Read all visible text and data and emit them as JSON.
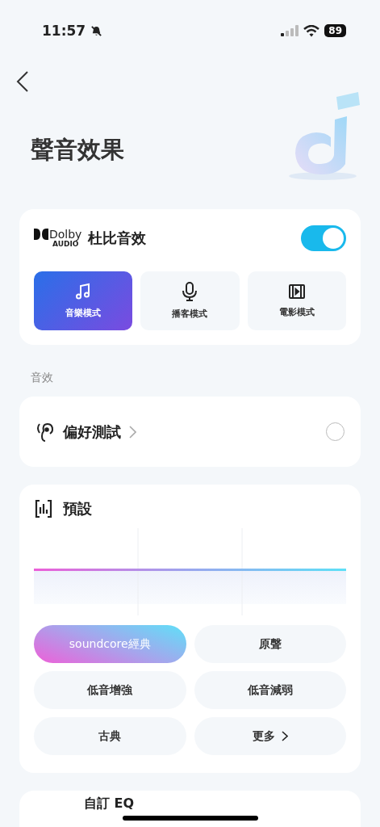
{
  "status_bar": {
    "time": "11:57",
    "battery": "89"
  },
  "header": {
    "title": "聲音效果"
  },
  "dolby": {
    "logo_word": "Dolby",
    "logo_sub": "AUDIO",
    "label": "杜比音效",
    "on": true,
    "modes": [
      {
        "label": "音樂模式",
        "kind": "music",
        "selected": true
      },
      {
        "label": "播客模式",
        "kind": "podcast",
        "selected": false
      },
      {
        "label": "電影模式",
        "kind": "movie",
        "selected": false
      }
    ]
  },
  "section_label": "音效",
  "preference_test": {
    "label": "偏好測試",
    "checked": false
  },
  "preset": {
    "title": "預設",
    "options": [
      {
        "label": "soundcore經典",
        "selected": true,
        "kind": "preset"
      },
      {
        "label": "原聲",
        "selected": false,
        "kind": "preset"
      },
      {
        "label": "低音增強",
        "selected": false,
        "kind": "preset"
      },
      {
        "label": "低音減弱",
        "selected": false,
        "kind": "preset"
      },
      {
        "label": "古典",
        "selected": false,
        "kind": "preset"
      },
      {
        "label": "更多",
        "selected": false,
        "kind": "more"
      }
    ]
  },
  "custom_eq": {
    "label": "自訂 EQ"
  }
}
